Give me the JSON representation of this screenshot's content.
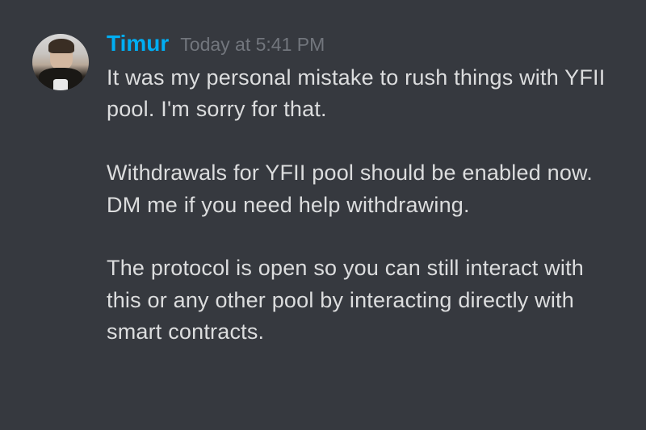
{
  "message": {
    "author": "Timur",
    "timestamp": "Today at 5:41 PM",
    "body": "It was my personal mistake to rush things with YFII pool. I'm sorry for that.\n\nWithdrawals for YFII pool should be enabled now. DM me if you need help withdrawing.\n\nThe protocol is open so you can still interact with this or any other pool by interacting directly with smart contracts."
  }
}
